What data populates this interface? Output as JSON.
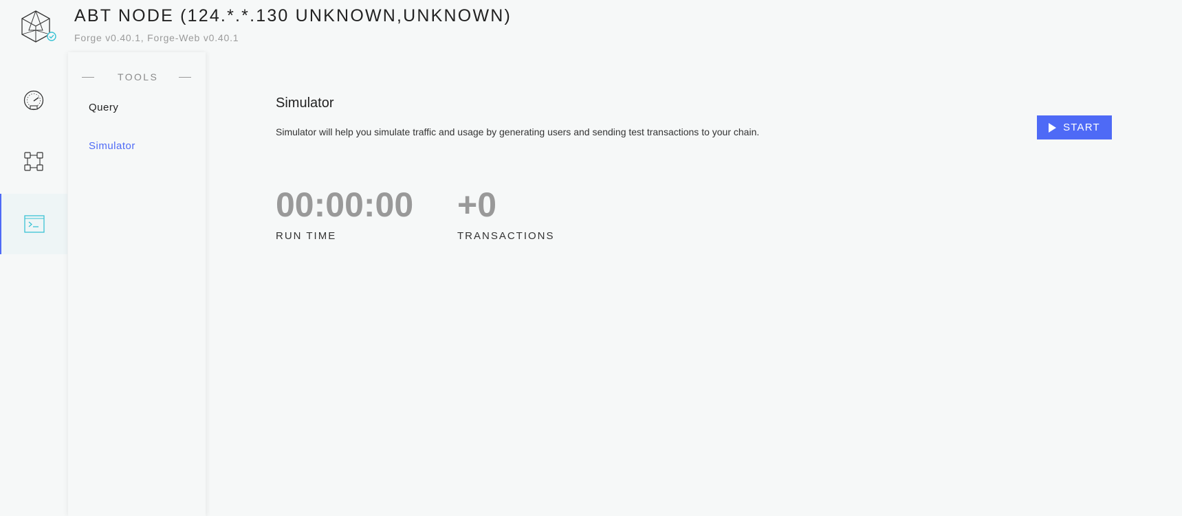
{
  "header": {
    "title": "ABT NODE (124.*.*.130 UNKNOWN,UNKNOWN)",
    "subtitle": "Forge v0.40.1, Forge-Web v0.40.1",
    "logo_icon": "cube-logo-icon",
    "status_icon": "check-circle-icon"
  },
  "rail": {
    "items": [
      {
        "icon": "dashboard-gauge-icon",
        "active": false
      },
      {
        "icon": "blocks-grid-icon",
        "active": false
      },
      {
        "icon": "terminal-icon",
        "active": true
      }
    ]
  },
  "submenu": {
    "title": "TOOLS",
    "items": [
      {
        "label": "Query",
        "active": false
      },
      {
        "label": "Simulator",
        "active": true
      }
    ]
  },
  "main": {
    "title": "Simulator",
    "description": "Simulator will help you simulate traffic and usage by generating users and sending test transactions to your chain.",
    "start_label": "START",
    "stats": [
      {
        "value": "00:00:00",
        "label": "RUN TIME"
      },
      {
        "value": "+0",
        "label": "TRANSACTIONS"
      }
    ]
  },
  "colors": {
    "accent": "#4e6af6",
    "teal": "#3ac3d4",
    "background": "#f6f8f8",
    "muted": "#999999"
  }
}
